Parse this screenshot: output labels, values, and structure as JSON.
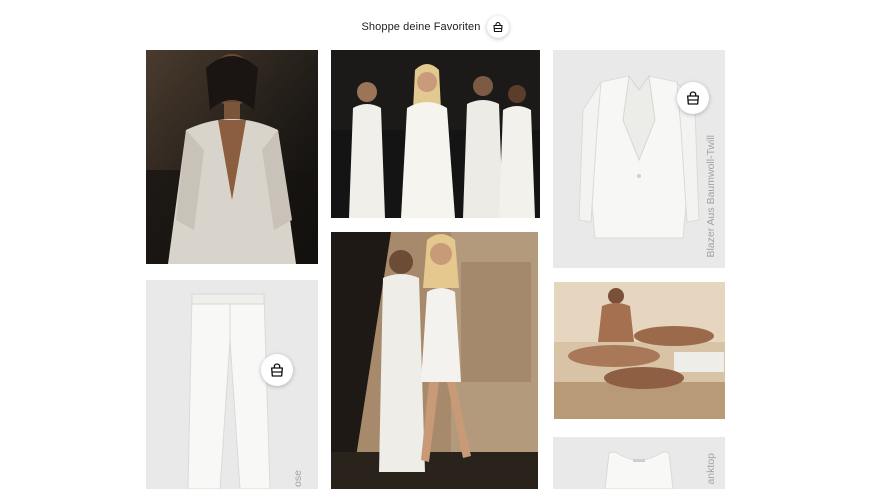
{
  "header": {
    "text": "Shoppe deine Favoriten",
    "icon": "shopping-bag-icon"
  },
  "tiles": [
    {
      "name": "photo-man-denim-jacket",
      "type": "photo",
      "description_icon": "photo"
    },
    {
      "name": "photo-group-white-suits",
      "type": "photo"
    },
    {
      "name": "product-blazer",
      "type": "product",
      "label": "Blazer Aus Baumwoll-Twill",
      "icon": "shopping-bag-icon"
    },
    {
      "name": "product-pants",
      "type": "product",
      "label": "ose",
      "icon": "shopping-bag-icon"
    },
    {
      "name": "photo-street-walk",
      "type": "photo"
    },
    {
      "name": "photo-beach-group",
      "type": "photo"
    },
    {
      "name": "product-tanktop",
      "type": "product",
      "label": "anktop"
    }
  ],
  "colors": {
    "product_bg": "#e9e9e9",
    "label_gray": "#a3a3a3"
  }
}
